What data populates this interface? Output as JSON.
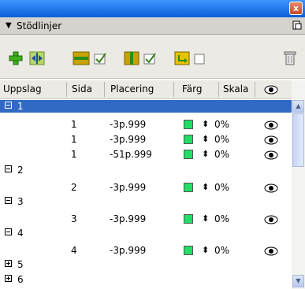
{
  "titlebar": {
    "close_label": "x"
  },
  "panel": {
    "title": "Stödlinjer"
  },
  "columns": {
    "uppslag": "Uppslag",
    "sida": "Sida",
    "placering": "Placering",
    "farg": "Färg",
    "skala": "Skala"
  },
  "groups": [
    {
      "label": "1",
      "expanded": true,
      "selected": true,
      "rows": [
        {
          "sida": "1",
          "placering": "-3p.999",
          "skala": "0%"
        },
        {
          "sida": "1",
          "placering": "-3p.999",
          "skala": "0%"
        },
        {
          "sida": "1",
          "placering": "-51p.999",
          "skala": "0%"
        }
      ]
    },
    {
      "label": "2",
      "expanded": true,
      "rows": [
        {
          "sida": "2",
          "placering": "-3p.999",
          "skala": "0%"
        }
      ]
    },
    {
      "label": "3",
      "expanded": true,
      "rows": [
        {
          "sida": "3",
          "placering": "-3p.999",
          "skala": "0%"
        }
      ]
    },
    {
      "label": "4",
      "expanded": true,
      "rows": [
        {
          "sida": "4",
          "placering": "-3p.999",
          "skala": "0%"
        }
      ]
    },
    {
      "label": "5",
      "expanded": false,
      "rows": []
    },
    {
      "label": "6",
      "expanded": false,
      "rows": []
    }
  ],
  "colors": {
    "titlebar": "#0a5fd8",
    "selection": "#316ac5",
    "guide_swatch": "#22dd66"
  },
  "icons": [
    "add-guide-icon",
    "spread-guide-icon",
    "horizontal-guide-icon",
    "check-icon",
    "vertical-guide-icon",
    "check-icon",
    "guide-lock-icon",
    "trash-icon"
  ]
}
